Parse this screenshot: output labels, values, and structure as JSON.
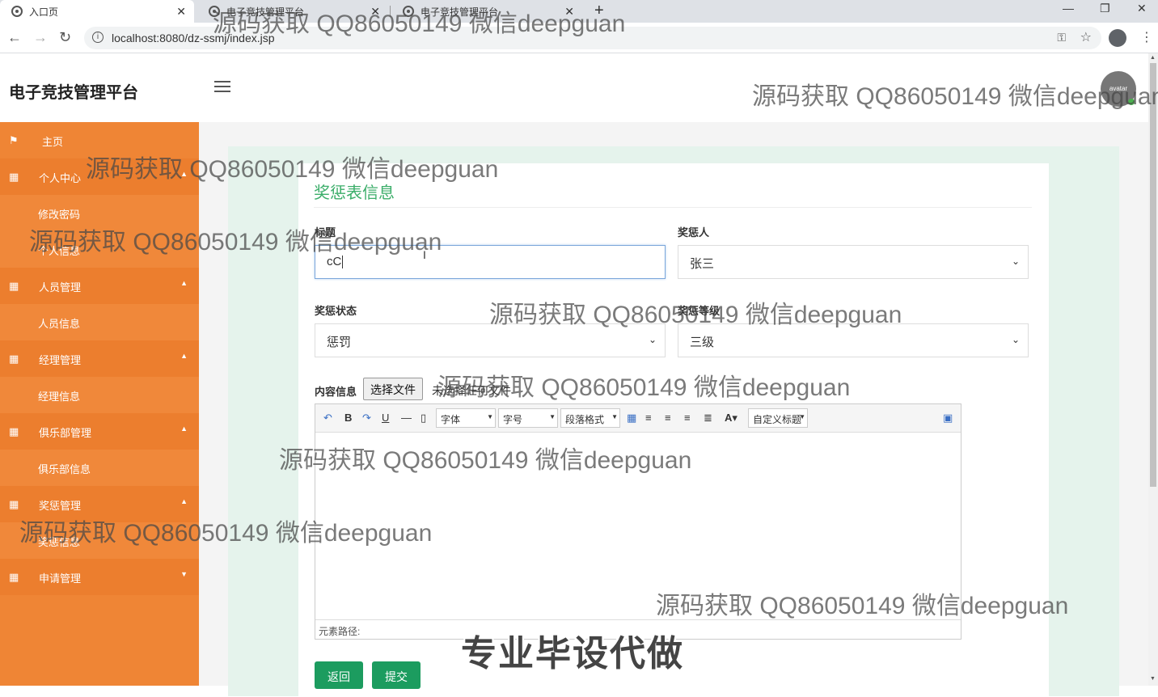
{
  "browser": {
    "tabs": [
      {
        "title": "入口页"
      },
      {
        "title": "电子竞技管理平台"
      },
      {
        "title": "电子竞技管理平台"
      }
    ],
    "url": "localhost:8080/dz-ssmj/index.jsp"
  },
  "header": {
    "brand": "电子竞技管理平台",
    "avatar_text": "avatar"
  },
  "sidebar": {
    "items": [
      {
        "label": "主页",
        "icon": "flag-icon"
      },
      {
        "label": "个人中心",
        "icon": "grid-icon"
      },
      {
        "label": "修改密码"
      },
      {
        "label": "个人信息"
      },
      {
        "label": "人员管理",
        "icon": "grid-icon"
      },
      {
        "label": "人员信息"
      },
      {
        "label": "经理管理",
        "icon": "grid-icon"
      },
      {
        "label": "经理信息"
      },
      {
        "label": "俱乐部管理",
        "icon": "grid-icon"
      },
      {
        "label": "俱乐部信息"
      },
      {
        "label": "奖惩管理",
        "icon": "grid-icon"
      },
      {
        "label": "奖惩信息"
      },
      {
        "label": "申请管理",
        "icon": "grid-icon"
      }
    ]
  },
  "form": {
    "title": "奖惩表信息",
    "fields": {
      "title_label": "标题",
      "title_value": "cC",
      "person_label": "奖惩人",
      "person_value": "张三",
      "status_label": "奖惩状态",
      "status_value": "惩罚",
      "level_label": "奖惩等级",
      "level_value": "三级",
      "content_label": "内容信息",
      "file_button": "选择文件",
      "file_status": "未选择任何文件"
    },
    "editor": {
      "font_select": "字体",
      "size_select": "字号",
      "paragraph_select": "段落格式",
      "custom_title_select": "自定义标题",
      "path_label": "元素路径:"
    },
    "buttons": {
      "back": "返回",
      "submit": "提交"
    }
  },
  "watermarks": {
    "text": "源码获取 QQ86050149 微信deepguan",
    "stamp": "专业毕设代做"
  }
}
